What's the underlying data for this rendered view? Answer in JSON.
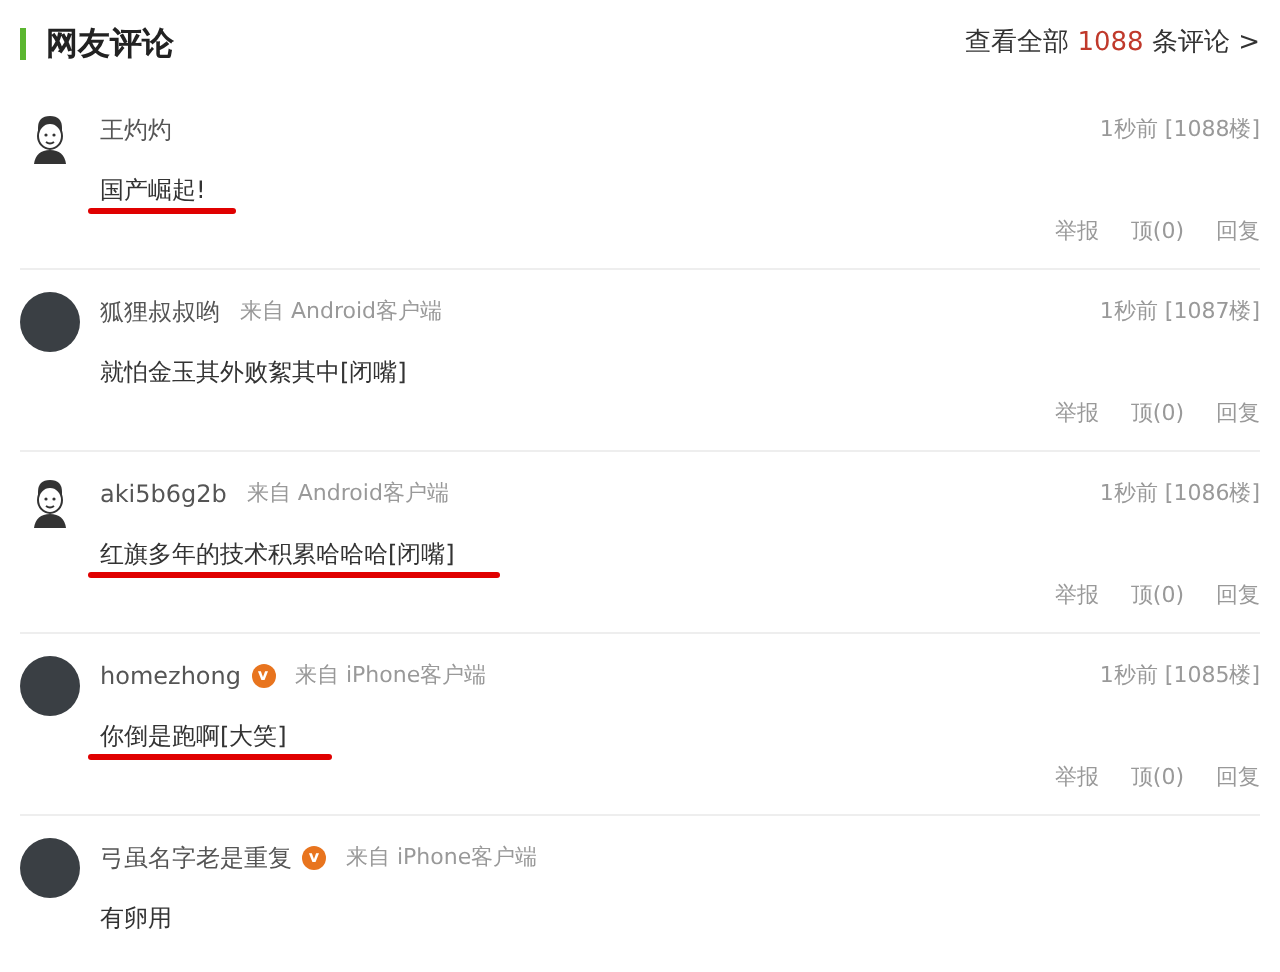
{
  "header": {
    "title": "网友评论",
    "view_all_prefix": "查看全部",
    "count": "1088",
    "view_all_suffix": "条评论 >"
  },
  "comments": [
    {
      "kind": "cartoon",
      "name": "王灼灼",
      "time": "1秒前 [1088楼]",
      "text": "国产崛起!",
      "underlined": true,
      "actions": [
        "举报",
        "顶(0)",
        "回复"
      ]
    },
    {
      "kind": "photo",
      "name": "狐狸叔叔哟",
      "source": "来自 Android客户端",
      "time": "1秒前 [1087楼]",
      "text": "就怕金玉其外败絮其中[闭嘴]",
      "underlined": false,
      "actions": [
        "举报",
        "顶(0)",
        "回复"
      ]
    },
    {
      "kind": "cartoon",
      "name": "aki5b6g2b",
      "source": "来自 Android客户端",
      "time": "1秒前 [1086楼]",
      "text": "红旗多年的技术积累哈哈哈[闭嘴]",
      "underlined": true,
      "actions": [
        "举报",
        "顶(0)",
        "回复"
      ]
    },
    {
      "kind": "photo",
      "name": "homezhong",
      "badge": "v",
      "source": "来自 iPhone客户端",
      "time": "1秒前 [1085楼]",
      "text": "你倒是跑啊[大笑]",
      "underlined": true,
      "actions": [
        "举报",
        "顶(0)",
        "回复"
      ]
    },
    {
      "kind": "photo",
      "name": "弓虽名字老是重复",
      "badge": "v",
      "source": "来自 iPhone客户端",
      "text": "有卵用",
      "underlined": false
    }
  ]
}
